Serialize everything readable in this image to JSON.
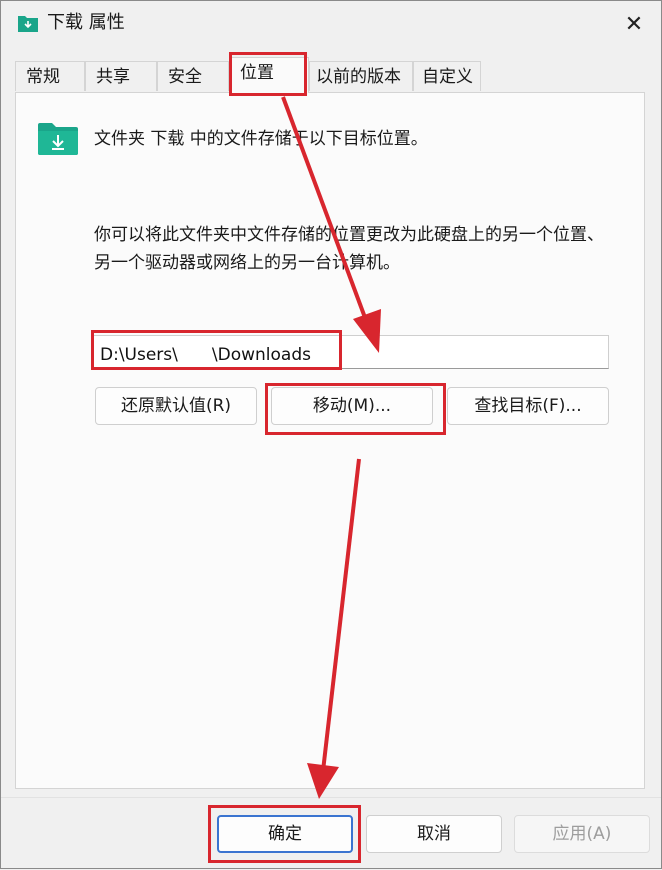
{
  "window": {
    "title": "下载 属性"
  },
  "tabs": [
    {
      "label": "常规"
    },
    {
      "label": "共享"
    },
    {
      "label": "安全"
    },
    {
      "label": "位置"
    },
    {
      "label": "以前的版本"
    },
    {
      "label": "自定义"
    }
  ],
  "location": {
    "info_text": "文件夹 下载 中的文件存储于以下目标位置。",
    "description": "你可以将此文件夹中文件存储的位置更改为此硬盘上的另一个位置、另一个驱动器或网络上的另一台计算机。",
    "path_value": "D:\\Users\\　　\\Downloads"
  },
  "buttons": {
    "restore_default": "还原默认值(R)",
    "move": "移动(M)...",
    "find_target": "查找目标(F)...",
    "ok": "确定",
    "cancel": "取消",
    "apply": "应用(A)"
  },
  "colors": {
    "annotation": "#d8262e",
    "folder": "#1aa58a",
    "focus_border": "#3b74d0"
  }
}
